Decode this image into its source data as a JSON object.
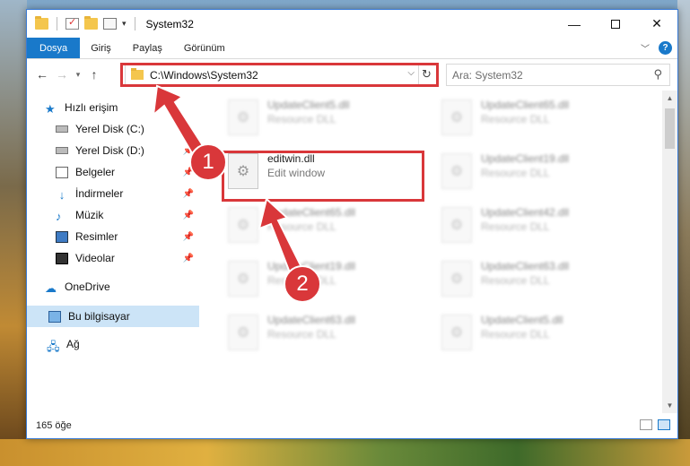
{
  "window": {
    "title": "System32",
    "buttons": {
      "minimize": "—",
      "maximize": "",
      "close": "✕"
    }
  },
  "ribbon": {
    "tabs": [
      "Dosya",
      "Giriş",
      "Paylaş",
      "Görünüm"
    ],
    "help": "?"
  },
  "address": {
    "path": "C:\\Windows\\System32",
    "search_placeholder": "Ara: System32"
  },
  "nav": {
    "items": [
      {
        "label": "Hızlı erişim",
        "icon": "star-icon"
      },
      {
        "label": "Yerel Disk (C:)",
        "icon": "drive-icon",
        "pinned": true
      },
      {
        "label": "Yerel Disk (D:)",
        "icon": "drive-icon",
        "pinned": true
      },
      {
        "label": "Belgeler",
        "icon": "documents-icon",
        "pinned": true
      },
      {
        "label": "İndirmeler",
        "icon": "downloads-icon",
        "pinned": true
      },
      {
        "label": "Müzik",
        "icon": "music-icon",
        "pinned": true
      },
      {
        "label": "Resimler",
        "icon": "pictures-icon",
        "pinned": true
      },
      {
        "label": "Videolar",
        "icon": "videos-icon",
        "pinned": true
      },
      {
        "label": "OneDrive",
        "icon": "cloud-icon"
      },
      {
        "label": "Bu bilgisayar",
        "icon": "computer-icon",
        "selected": true
      },
      {
        "label": "Ağ",
        "icon": "network-icon"
      }
    ]
  },
  "files": [
    {
      "name": "UpdateClient5.dll",
      "desc": "Resource DLL",
      "blurred": true
    },
    {
      "name": "UpdateClient65.dll",
      "desc": "Resource DLL",
      "blurred": true
    },
    {
      "name": "editwin.dll",
      "desc": "Edit window",
      "blurred": false
    },
    {
      "name": "UpdateClient19.dll",
      "desc": "Resource DLL",
      "blurred": true
    },
    {
      "name": "UpdateClient65.dll",
      "desc": "Resource DLL",
      "blurred": true
    },
    {
      "name": "UpdateClient42.dll",
      "desc": "Resource DLL",
      "blurred": true
    },
    {
      "name": "UpdateClient19.dll",
      "desc": "Resource DLL",
      "blurred": true
    },
    {
      "name": "UpdateClient63.dll",
      "desc": "Resource DLL",
      "blurred": true
    },
    {
      "name": "UpdateClient63.dll",
      "desc": "Resource DLL",
      "blurred": true
    },
    {
      "name": "UpdateClient5.dll",
      "desc": "Resource DLL",
      "blurred": true
    }
  ],
  "status": {
    "count": "165 öğe"
  },
  "callouts": {
    "one": "1",
    "two": "2"
  },
  "colors": {
    "accent": "#1979ca",
    "highlight": "#d9373a"
  }
}
